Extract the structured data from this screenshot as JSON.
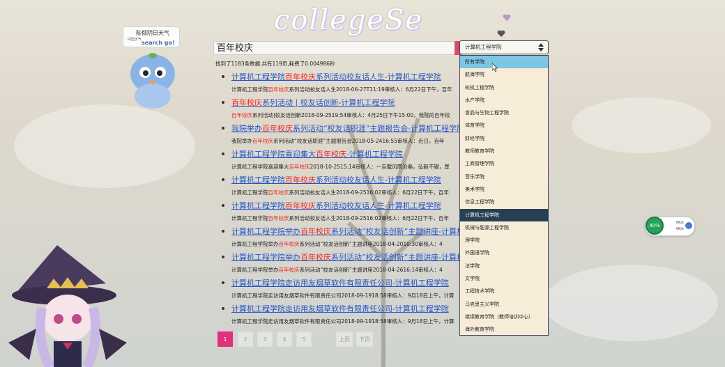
{
  "logo": {
    "text": "collegeSe"
  },
  "weather": {
    "title": "陈郁阴日天气",
    "sub": "中国天气",
    "link": "search go!"
  },
  "search": {
    "query": "百年校庆"
  },
  "stats": {
    "text": "找到了1183条数据,共有119页,耗费了0.004986秒"
  },
  "results": [
    {
      "title_pre": "计算机工程学院",
      "title_hl": "百年校庆",
      "title_post": "系列活动校友话人生-计算机工程学院",
      "snip_pre": "计算机工程学院",
      "snip_hl": "百年校庆",
      "snip_post": "系列活动校友话人生2018-06-27T11:19审核人：6月22日下午，百年"
    },
    {
      "title_pre": "",
      "title_hl": "百年校庆",
      "title_post": "系列活动 | 校友话创新-计算机工程学院",
      "snip_pre": "",
      "snip_hl": "百年校庆",
      "snip_post": "系列活动|校友话创新2018-09-2519:54审核人：4月25日下午15:00，我院的百年校"
    },
    {
      "title_pre": "我院举办",
      "title_hl": "百年校庆",
      "title_post": "系列活动“校友话职涯”主题报告会-计算机工程学院",
      "snip_pre": "我院举办",
      "snip_hl": "百年校庆",
      "snip_post": "系列活动“校友话职涯”主题报告会2018-05-2416:55审核人：近日，百年"
    },
    {
      "title_pre": "计算机工程学院喜迎集大",
      "title_hl": "百年校庆",
      "title_post": "-计算机工程学院",
      "snip_pre": "计算机工程学院喜迎集大",
      "snip_hl": "百年校庆",
      "snip_post": "2018-10-2515:14审核人：一百载风雨沧桑，弘毅不辍，厚"
    },
    {
      "title_pre": "计算机工程学院",
      "title_hl": "百年校庆",
      "title_post": "系列活动校友话人生-计算机工程学院",
      "snip_pre": "计算机工程学院",
      "snip_hl": "百年校庆",
      "snip_post": "系列活动校友话人生2018-09-2516:02审核人：6月22日下午，百年"
    },
    {
      "title_pre": "计算机工程学院",
      "title_hl": "百年校庆",
      "title_post": "系列活动校友话人生-计算机工程学院",
      "snip_pre": "计算机工程学院",
      "snip_hl": "百年校庆",
      "snip_post": "系列活动校友话人生2018-09-2516:02审核人：6月22日下午，百年"
    },
    {
      "title_pre": "计算机工程学院举办",
      "title_hl": "百年校庆",
      "title_post": "系列活动“校友话创新”主题讲座-计算机",
      "snip_pre": "计算机工程学院举办",
      "snip_hl": "百年校庆",
      "snip_post": "系列活动“校友话创新”主题讲座2018-04-2010:30审核人：4"
    },
    {
      "title_pre": "计算机工程学院举办",
      "title_hl": "百年校庆",
      "title_post": "系列活动“校友话创新”主题讲座-计算机",
      "snip_pre": "计算机工程学院举办",
      "snip_hl": "百年校庆",
      "snip_post": "系列活动“校友话创新”主题讲座2018-04-2616:14审核人：4"
    },
    {
      "title_pre": "计算机工程学院走访用友烟草软件有限责任公司-计算机工程学院",
      "title_hl": "",
      "title_post": "",
      "snip_pre": "计算机工程学院走访用友烟草软件有限责任公司2018-09-1918:58审核人：9月18日上午，计算",
      "snip_hl": "",
      "snip_post": ""
    },
    {
      "title_pre": "计算机工程学院走访用友烟草软件有限责任公司-计算机工程学院",
      "title_hl": "",
      "title_post": "",
      "snip_pre": "计算机工程学院走访用友烟草软件有限责任公司2018-09-1918:58审核人：9月18日上午，计算",
      "snip_hl": "",
      "snip_post": ""
    }
  ],
  "pager": {
    "pages": [
      "1",
      "2",
      "3",
      "4",
      "5"
    ],
    "prev": "上页",
    "next": "下页"
  },
  "select": {
    "value": "计算机工程学院"
  },
  "dropdown": {
    "options": [
      "所有学院",
      "航海学院",
      "轮机工程学院",
      "水产学院",
      "食品与生物工程学院",
      "体育学院",
      "财经学院",
      "教师教育学院",
      "工商管理学院",
      "音乐学院",
      "美术学院",
      "信息工程学院",
      "计算机工程学院",
      "机械与能源工程学院",
      "理学院",
      "外国语学院",
      "法学院",
      "文学院",
      "工程技术学院",
      "马克思主义学院",
      "继续教育学院（教师培训中心）",
      "海外教育学院"
    ],
    "hover_index": 0,
    "selected_index": 12
  },
  "netwidget": {
    "percent": "40%",
    "up": "0K/s",
    "down": "0K/s"
  },
  "colors": {
    "accent": "#e2307a",
    "link": "#2455c9",
    "highlight": "#e22",
    "selected": "#263f53",
    "hover": "#7cc6e4"
  }
}
